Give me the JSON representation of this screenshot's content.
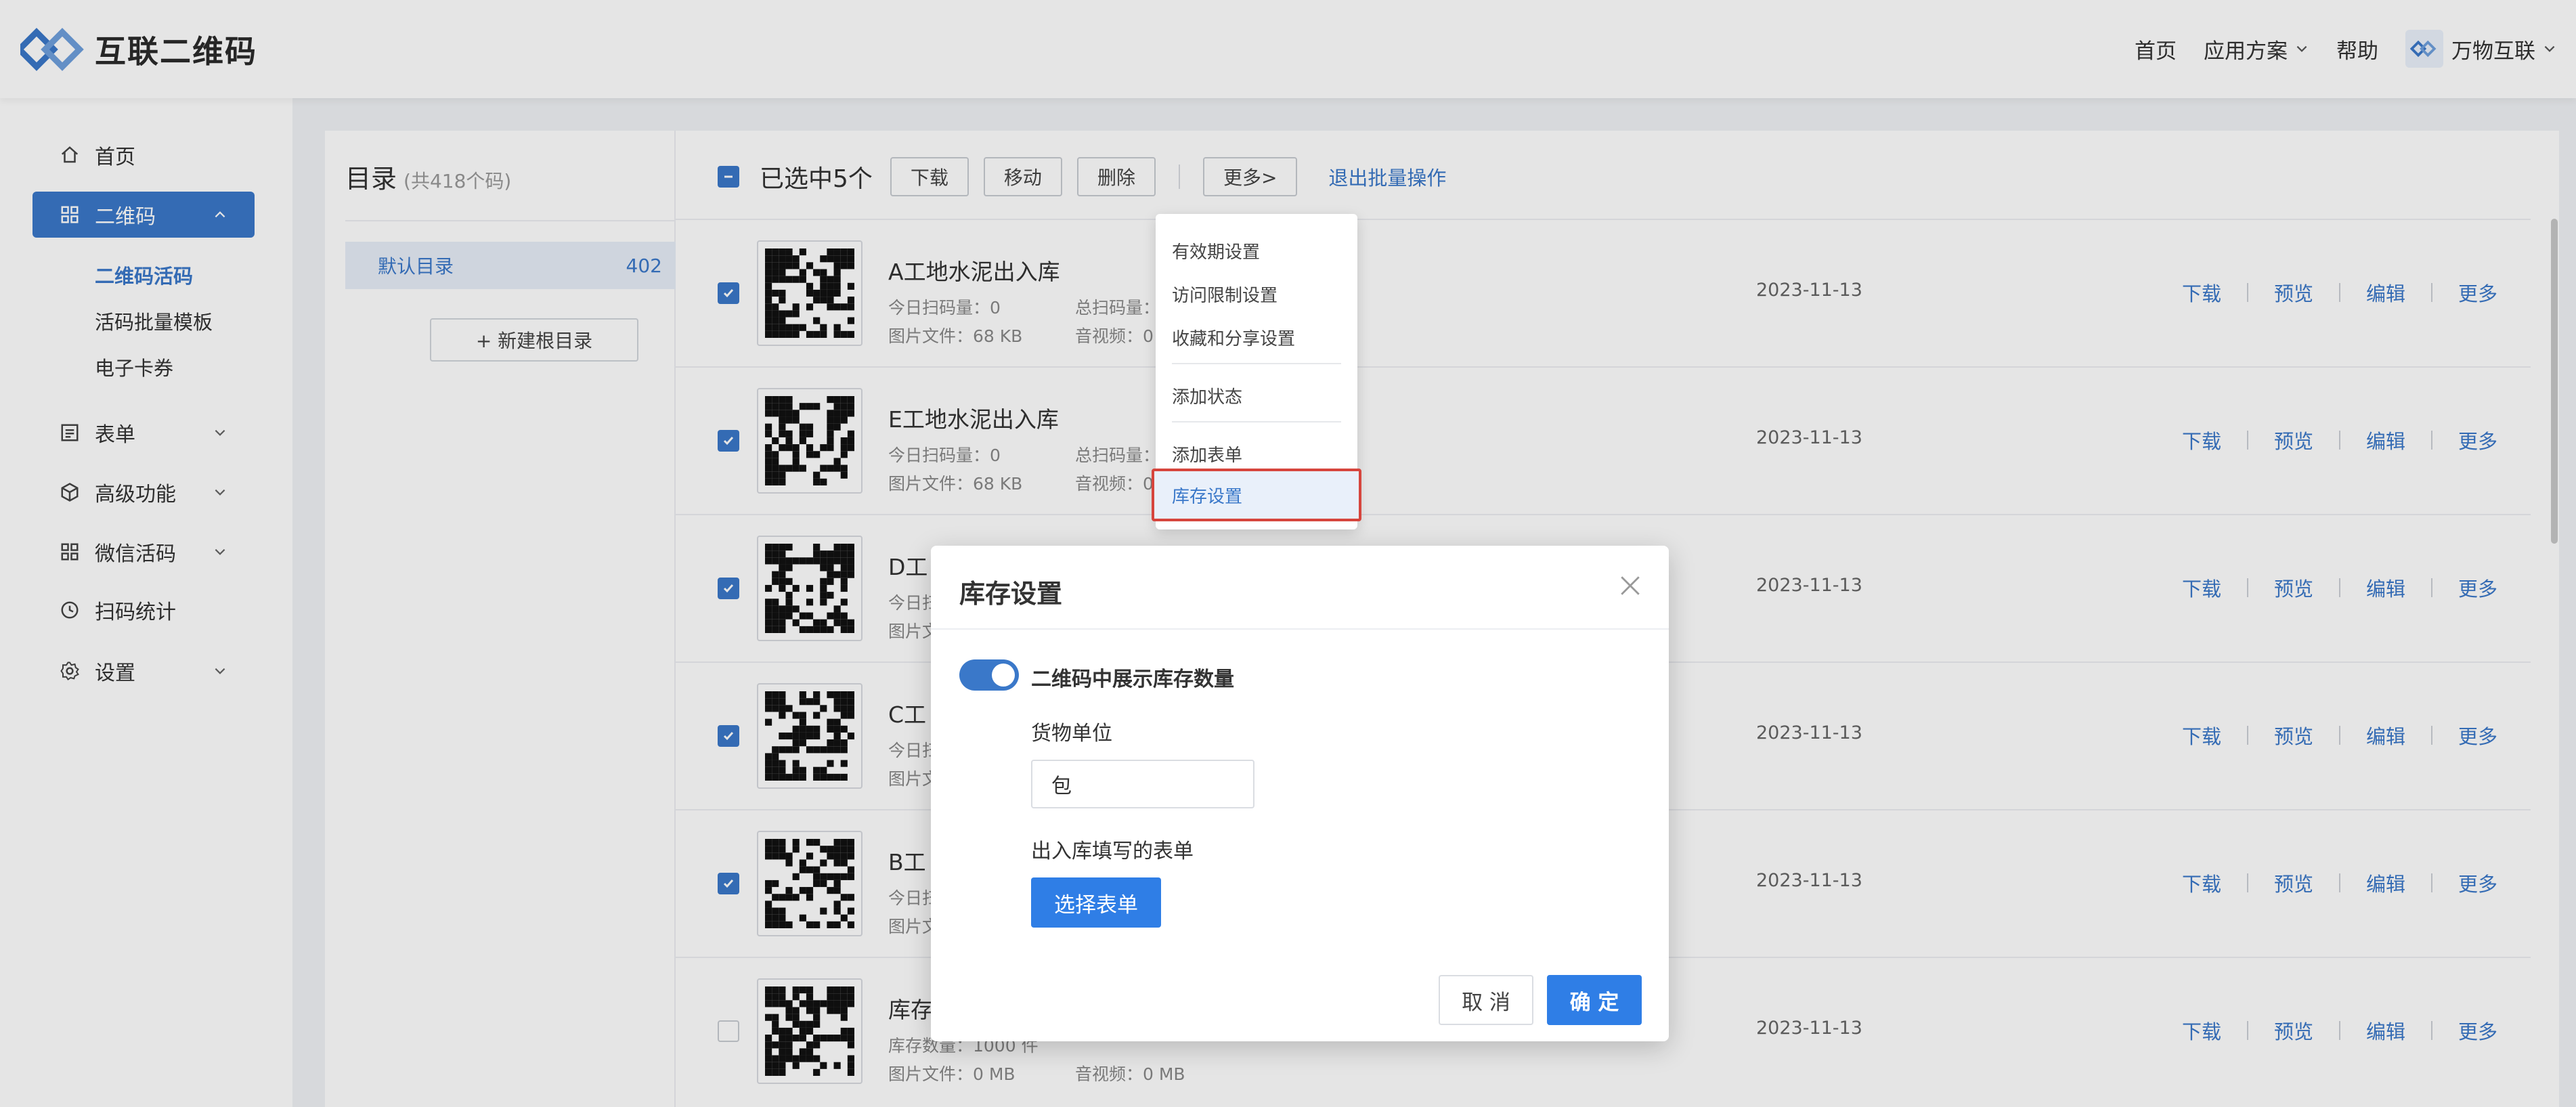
{
  "colors": {
    "accent": "#3a78c9",
    "primary_button": "#2f7ee6",
    "highlight_border": "#d6453d"
  },
  "header": {
    "app_name": "互联二维码",
    "nav": {
      "home": "首页",
      "solutions": "应用方案",
      "help": "帮助",
      "user": "万物互联"
    }
  },
  "sidebar": {
    "home": "首页",
    "qrcode": "二维码",
    "qrcode_sub": [
      "二维码活码",
      "活码批量模板",
      "电子卡券"
    ],
    "form": "表单",
    "advanced": "高级功能",
    "wechat": "微信活码",
    "stats": "扫码统计",
    "settings": "设置"
  },
  "directory": {
    "title": "目录",
    "count": "(共418个码)",
    "item_label": "默认目录",
    "item_count": "402",
    "new_button": "+ 新建根目录"
  },
  "toolbar": {
    "selected": "已选中5个",
    "download": "下载",
    "move": "移动",
    "delete": "删除",
    "more": "更多>",
    "exit": "退出批量操作"
  },
  "rows": [
    {
      "name": "A工地水泥出入库",
      "today": "今日扫码量：0",
      "total": "总扫码量：",
      "file": "图片文件：68 KB",
      "video": "音视频：0",
      "date": "2023-11-13",
      "checked": true
    },
    {
      "name": "E工地水泥出入库",
      "today": "今日扫码量：0",
      "total": "总扫码量：",
      "file": "图片文件：68 KB",
      "video": "音视频：0",
      "date": "2023-11-13",
      "checked": true
    },
    {
      "name": "D工",
      "today": "今日扫",
      "total": "",
      "file": "图片文",
      "video": "",
      "date": "2023-11-13",
      "checked": true
    },
    {
      "name": "C工",
      "today": "今日扫",
      "total": "",
      "file": "图片文",
      "video": "",
      "date": "2023-11-13",
      "checked": true
    },
    {
      "name": "B工",
      "today": "今日扫",
      "total": "",
      "file": "图片文",
      "video": "",
      "date": "2023-11-13",
      "checked": true
    },
    {
      "name": "库存",
      "today": "库存数量：1000 件",
      "total": "",
      "file": "图片文件：0 MB",
      "video": "音视频：0 MB",
      "date": "2023-11-13",
      "checked": false
    }
  ],
  "row_actions": {
    "download": "下载",
    "preview": "预览",
    "edit": "编辑",
    "more": "更多"
  },
  "dropdown": {
    "items": [
      "有效期设置",
      "访问限制设置",
      "收藏和分享设置",
      "添加状态",
      "添加表单",
      "库存设置"
    ]
  },
  "modal": {
    "title": "库存设置",
    "toggle_label": "二维码中展示库存数量",
    "toggle_on": true,
    "unit_label": "货物单位",
    "unit_value": "包",
    "form_label": "出入库填写的表单",
    "select_form": "选择表单",
    "cancel": "取 消",
    "confirm": "确 定"
  }
}
